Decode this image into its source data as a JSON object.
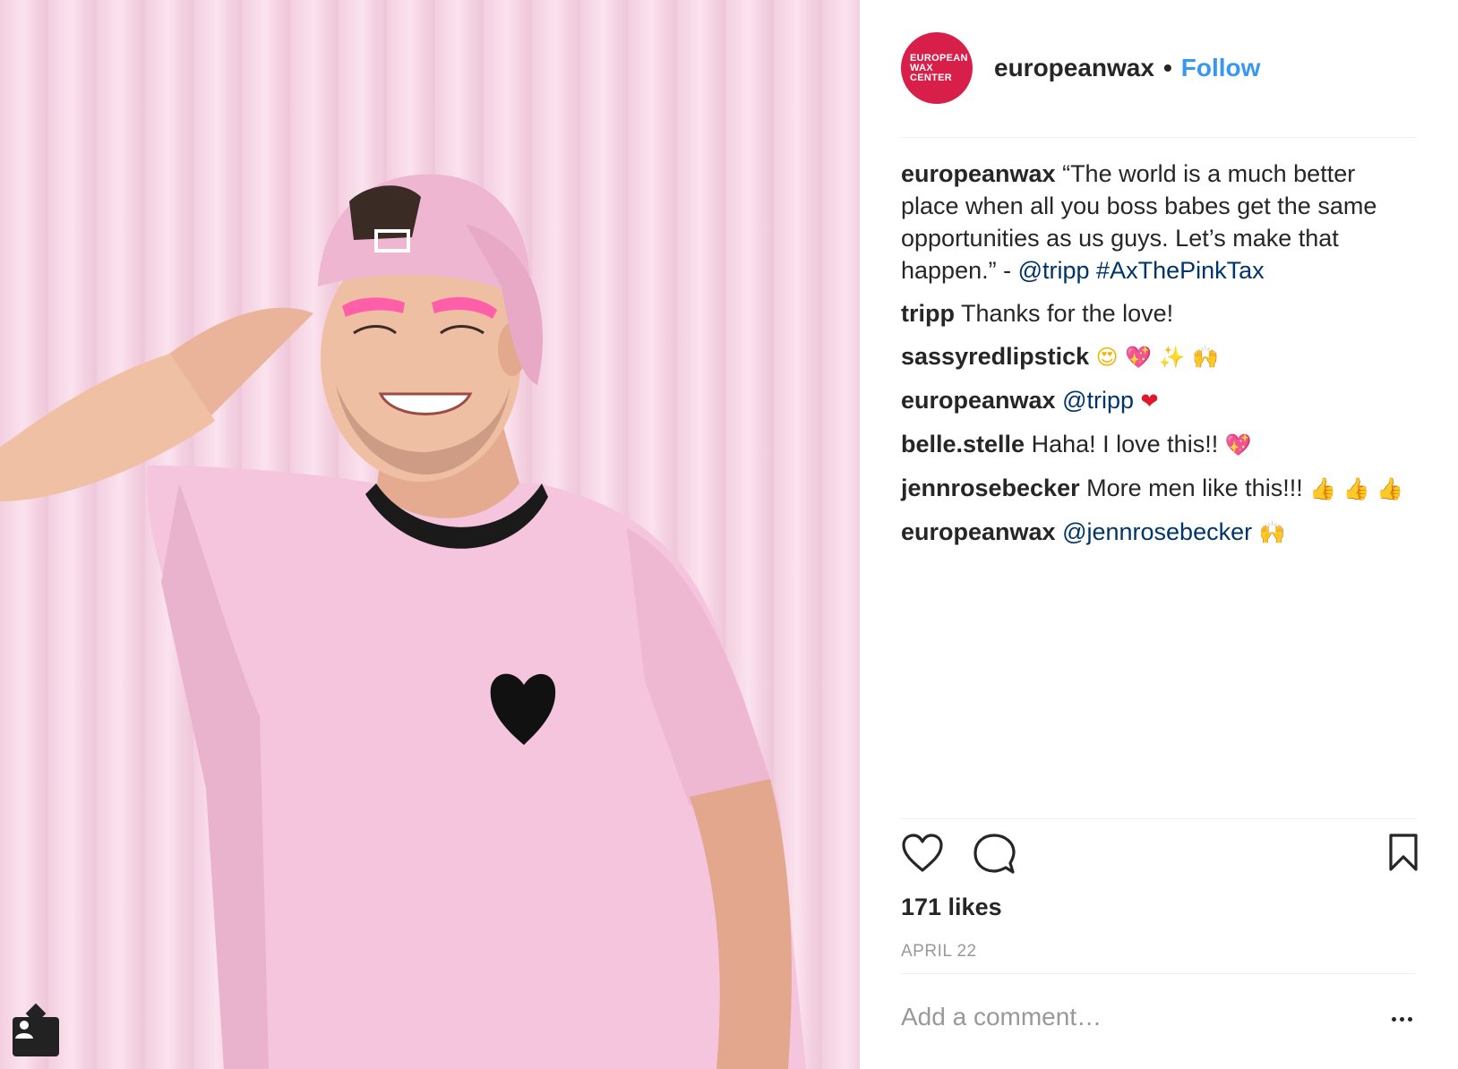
{
  "post": {
    "image_alt": "Smiling man in pink t-shirt and backwards pink cap in front of pink wall"
  },
  "header": {
    "avatar_text": [
      "EUROPEAN",
      "WAX",
      "CENTER"
    ],
    "username": "europeanwax",
    "separator": "•",
    "follow_label": "Follow"
  },
  "caption": {
    "username": "europeanwax",
    "text": "“The world is a much better place when all you boss babes get the same opportunities as us guys. Let’s make that happen.” - ",
    "mention": "@tripp",
    "hashtag": "#AxThePinkTax"
  },
  "comments": [
    {
      "username": "tripp",
      "text": "Thanks for the love!"
    },
    {
      "username": "sassyredlipstick",
      "emojis": [
        "😍",
        "💖",
        "✨",
        "🙌"
      ]
    },
    {
      "username": "europeanwax",
      "mention": "@tripp",
      "emojis": [
        "❤"
      ]
    },
    {
      "username": "belle.stelle",
      "text": "Haha! I love this!!",
      "emojis": [
        "💖"
      ]
    },
    {
      "username": "jennrosebecker",
      "text": "More men like this!!!",
      "emojis": [
        "👍",
        "👍",
        "👍"
      ]
    },
    {
      "username": "europeanwax",
      "mention": "@jennrosebecker",
      "emojis": [
        "🙌"
      ]
    }
  ],
  "actions": {
    "like_icon": "heart-icon",
    "comment_icon": "speech-bubble-icon",
    "save_icon": "bookmark-icon"
  },
  "likes": "171 likes",
  "date": "APRIL 22",
  "add_comment": {
    "placeholder": "Add a comment…"
  },
  "colors": {
    "follow": "#3897f0",
    "link": "#003569",
    "brand": "#d71f4a"
  }
}
